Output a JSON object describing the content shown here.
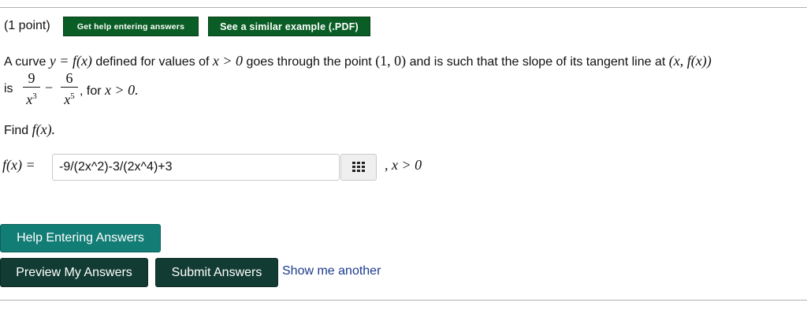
{
  "header": {
    "points": "(1 point)",
    "help_button": "Get help entering answers",
    "similar_button": "See a similar example (.PDF)"
  },
  "problem": {
    "line1_a": "A curve ",
    "line1_eq": "y = f(x)",
    "line1_b": " defined for values of ",
    "line1_cond": "x > 0",
    "line1_c": " goes through the point ",
    "line1_point": "(1, 0)",
    "line1_d": " and is such that the slope of its tangent line at ",
    "line1_pt2": "(x, f(x))",
    "line2_is": "is",
    "frac1_num": "9",
    "frac1_den": "x",
    "frac1_exp": "3",
    "minus": "−",
    "frac2_num": "6",
    "frac2_den": "x",
    "frac2_exp": "5",
    "line2_tail_a": ", for ",
    "line2_tail_cond": "x > 0.",
    "find_a": "Find ",
    "find_b": "f(x).",
    "fx_label": "f(x) =",
    "condition": ", x > 0"
  },
  "answer": {
    "value": "-9/(2x^2)-3/(2x^4)+3",
    "grid_icon": "grid-icon"
  },
  "actions": {
    "help_entering": "Help Entering Answers",
    "preview": "Preview My Answers",
    "submit": "Submit Answers",
    "show_another": "Show me another"
  }
}
